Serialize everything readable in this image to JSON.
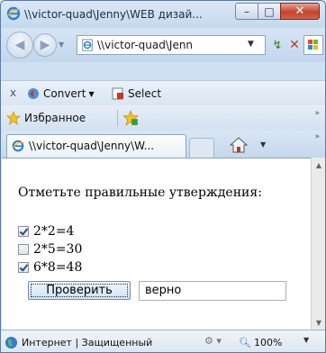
{
  "window": {
    "title": "\\\\victor-quad\\Jenny\\WEB дизай...",
    "min_label": "–",
    "max_label": "□",
    "close_label": "✕"
  },
  "address": {
    "url": "\\\\victor-quad\\Jenn",
    "dropdown": "▼",
    "go": "↯",
    "stop": "✕"
  },
  "commandbar": {
    "close_glyph": "x",
    "convert_label": "Convert",
    "convert_drop": "▼",
    "select_label": "Select"
  },
  "favorites": {
    "label": "Избранное",
    "chevron": "»"
  },
  "tabs": {
    "active_label": "\\\\victor-quad\\Jenny\\W...",
    "home_drop": "▼",
    "chevron": "»"
  },
  "page": {
    "prompt": "Отметьте правильные утверждения:",
    "items": [
      {
        "label": "2*2=4",
        "checked": true
      },
      {
        "label": "2*5=30",
        "checked": false
      },
      {
        "label": "6*8=48",
        "checked": true
      }
    ],
    "check_button": "Проверить",
    "result_value": "верно"
  },
  "statusbar": {
    "zone": "Интернет | Защищенный",
    "zoom": "100%",
    "drop": "▼"
  },
  "colors": {
    "accent": "#2a4d8c",
    "close_red": "#c4442a"
  }
}
